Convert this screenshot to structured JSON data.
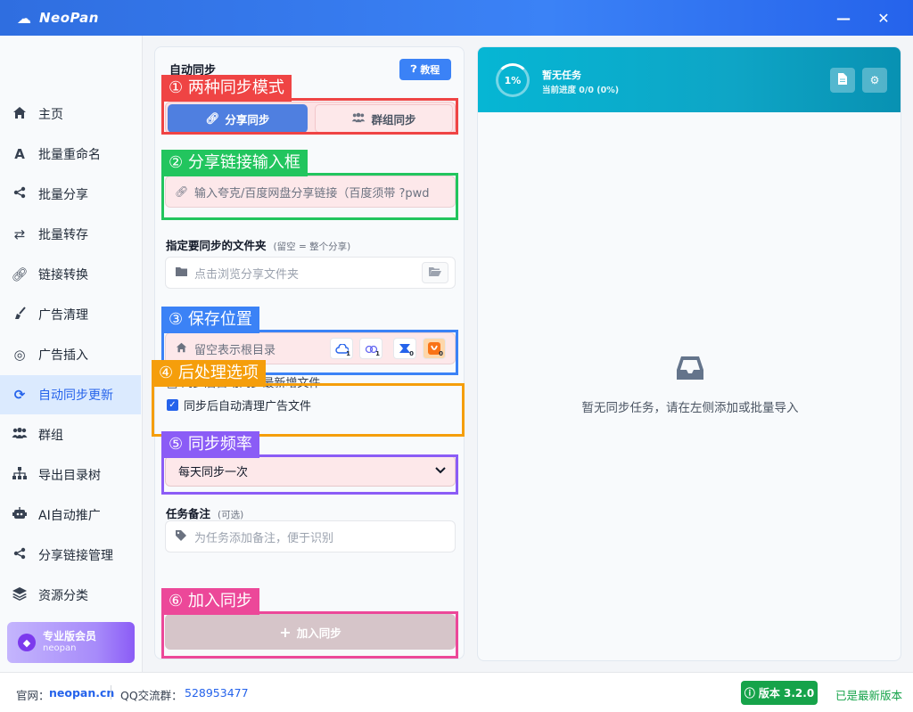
{
  "app": {
    "title": "NeoPan"
  },
  "window": {
    "minimize": "—",
    "close": "✕"
  },
  "sidebar": {
    "items": [
      {
        "label": "主页",
        "icon": "home-icon",
        "active": false
      },
      {
        "label": "批量重命名",
        "icon": "font-icon",
        "active": false
      },
      {
        "label": "批量分享",
        "icon": "share-icon",
        "active": false
      },
      {
        "label": "批量转存",
        "icon": "exchange-icon",
        "active": false
      },
      {
        "label": "链接转换",
        "icon": "link-icon",
        "active": false
      },
      {
        "label": "广告清理",
        "icon": "broom-icon",
        "active": false
      },
      {
        "label": "广告插入",
        "icon": "bullseye-icon",
        "active": false
      },
      {
        "label": "自动同步更新",
        "icon": "sync-icon",
        "active": true
      },
      {
        "label": "群组",
        "icon": "users-icon",
        "active": false
      },
      {
        "label": "导出目录树",
        "icon": "sitemap-icon",
        "active": false
      },
      {
        "label": "AI自动推广",
        "icon": "robot-icon",
        "active": false
      },
      {
        "label": "分享链接管理",
        "icon": "share-alt-icon",
        "active": false
      },
      {
        "label": "资源分类",
        "icon": "layers-icon",
        "active": false
      }
    ],
    "pro": {
      "title": "专业版会员",
      "user": "neopan"
    }
  },
  "form": {
    "title": "自动同步",
    "tutorial": "教程",
    "modes": [
      "分享同步",
      "群组同步"
    ],
    "share_link_placeholder": "输入夸克/百度网盘分享链接（百度须带 ?pwd",
    "folder_label": "指定要同步的文件夹",
    "folder_hint": "(留空 = 整个分享)",
    "folder_placeholder": "点击浏览分享文件夹",
    "save_placeholder": "留空表示根目录",
    "clouds": [
      {
        "icon": "baidu-cloud-icon",
        "count": "1",
        "color": "#2563eb"
      },
      {
        "icon": "aliyun-cloud-icon",
        "count": "1",
        "color": "#6366f1"
      },
      {
        "icon": "xunlei-icon",
        "count": "0",
        "color": "#2563eb"
      },
      {
        "icon": "uc-icon",
        "count": "0",
        "color": "#f97316"
      }
    ],
    "hidden_option": "□ 同步后自动同步最新增文件",
    "auto_clean": "同步后自动清理广告文件",
    "frequency": "每天同步一次",
    "note_label": "任务备注",
    "note_hint": "(可选)",
    "note_placeholder": "为任务添加备注，便于识别",
    "add_button": "加入同步"
  },
  "callouts": [
    {
      "num": "①",
      "text": "两种同步模式",
      "color": "#ef4444"
    },
    {
      "num": "②",
      "text": "分享链接输入框",
      "color": "#22c55e"
    },
    {
      "num": "③",
      "text": "保存位置",
      "color": "#3b82f6"
    },
    {
      "num": "④",
      "text": "后处理选项",
      "color": "#f59e0b"
    },
    {
      "num": "⑤",
      "text": "同步频率",
      "color": "#8b5cf6"
    },
    {
      "num": "⑥",
      "text": "加入同步",
      "color": "#ec4899"
    }
  ],
  "task": {
    "percent": "1%",
    "title": "暂无任务",
    "progress": "当前进度 0/0 (0%)",
    "empty": "暂无同步任务，请在左侧添加或批量导入"
  },
  "footer": {
    "site_label": "官网：",
    "site": "neopan.cn",
    "qq_label": "QQ交流群：",
    "qq": "528953477",
    "version": "版本 3.2.0",
    "latest": "已是最新版本"
  }
}
